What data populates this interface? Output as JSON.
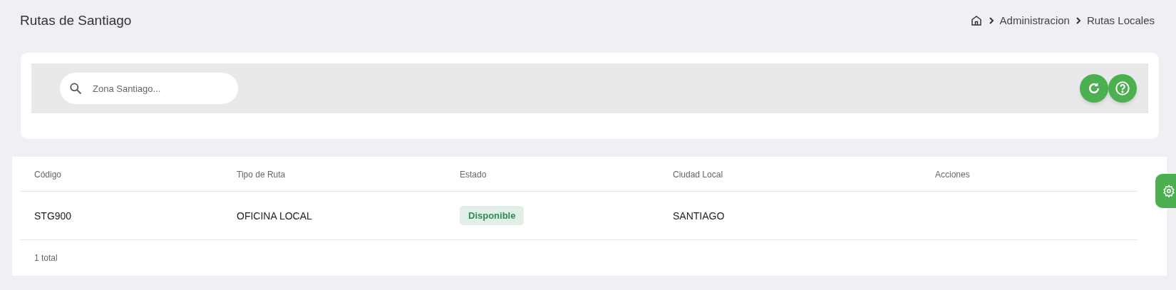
{
  "page_title": "Rutas de Santiago",
  "breadcrumb": [
    "Administracion",
    "Rutas Locales"
  ],
  "search": {
    "placeholder": "Zona Santiago..."
  },
  "table": {
    "columns": [
      "Código",
      "Tipo de Ruta",
      "Estado",
      "Ciudad Local",
      "Acciones"
    ],
    "rows": [
      {
        "cells": [
          "STG900",
          "OFICINA LOCAL",
          {
            "kind": "success",
            "text": "Disponible"
          },
          "SANTIAGO"
        ]
      }
    ],
    "footer": "1 total"
  }
}
